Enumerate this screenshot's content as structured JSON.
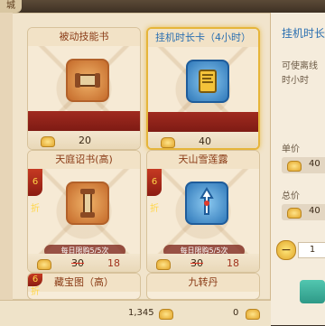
{
  "tab": {
    "label": "城"
  },
  "cards": [
    {
      "name": "被动技能书",
      "price": "20",
      "icon": "scroll-icon",
      "frame_color": "#c46a2a"
    },
    {
      "name": "挂机时长卡（4小时）",
      "price": "40",
      "icon": "card-icon",
      "frame_color": "#2f78b9",
      "selected": true
    },
    {
      "name": "天庭诏书(高)",
      "limit_text": "每日限购5/5次",
      "old_price": "30",
      "new_price": "18",
      "discount": "6折",
      "icon": "scroll-icon"
    },
    {
      "name": "天山雪莲露",
      "limit_text": "每日限购5/5次",
      "old_price": "30",
      "new_price": "18",
      "discount": "6折",
      "icon": "potion-icon"
    },
    {
      "name": "藏宝图（高）",
      "discount": "6折"
    },
    {
      "name": "九转丹"
    }
  ],
  "side": {
    "title": "挂机时长",
    "desc": "可使离线时小时",
    "unit_price_label": "单价",
    "unit_price": "40",
    "total_price_label": "总价",
    "total_price": "40",
    "quantity": "1"
  },
  "currency": {
    "gold_left": "1,345",
    "gold_right": "0"
  }
}
